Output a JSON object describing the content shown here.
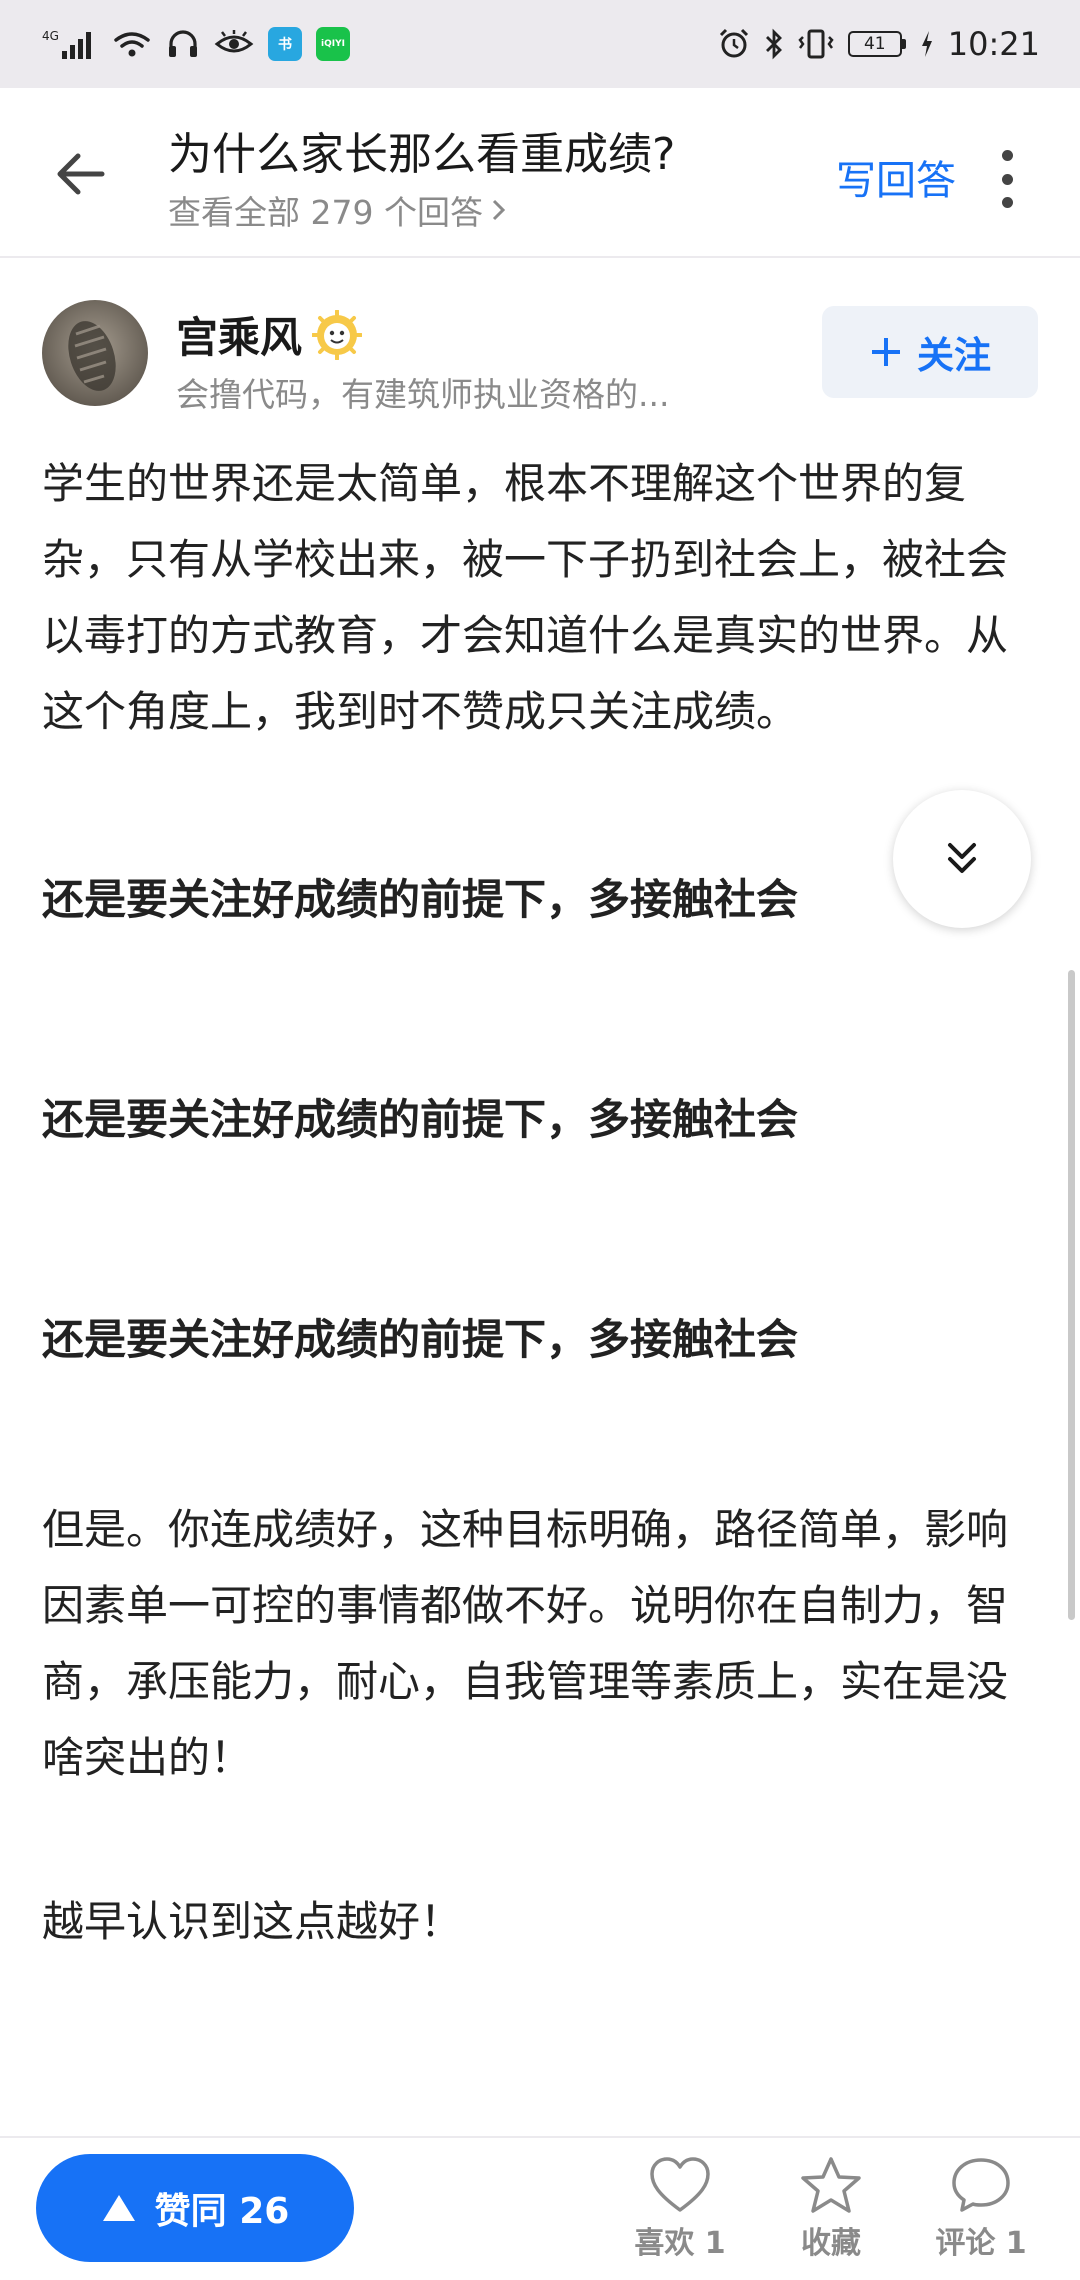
{
  "status_bar": {
    "network": "4G",
    "battery": "41",
    "time": "10:21",
    "badge_1": "书",
    "badge_2": "iQIYI"
  },
  "header": {
    "title": "为什么家长那么看重成绩?",
    "subtitle": "查看全部 279 个回答",
    "write_answer": "写回答"
  },
  "author": {
    "name": "宫乘风",
    "description": "会撸代码，有建筑师执业资格的...",
    "follow_label": "关注"
  },
  "content": {
    "paragraphs": [
      "学生的世界还是太简单，根本不理解这个世界的复杂，只有从学校出来，被一下子扔到社会上，被社会以毒打的方式教育，才会知道什么是真实的世界。从这个角度上，我到时不赞成只关注成绩。",
      "还是要关注好成绩的前提下，多接触社会",
      "还是要关注好成绩的前提下，多接触社会",
      "还是要关注好成绩的前提下，多接触社会",
      "但是。你连成绩好，这种目标明确，路径简单，影响因素单一可控的事情都做不好。说明你在自制力，智商，承压能力，耐心，自我管理等素质上，实在是没啥突出的！",
      "越早认识到这点越好！"
    ]
  },
  "bottom_bar": {
    "agree_label": "赞同 26",
    "like_label": "喜欢 1",
    "collect_label": "收藏",
    "comment_label": "评论 1"
  },
  "colors": {
    "accent": "#1772f6",
    "status_bg": "#eceaee",
    "muted_text": "#8a8a8a"
  }
}
